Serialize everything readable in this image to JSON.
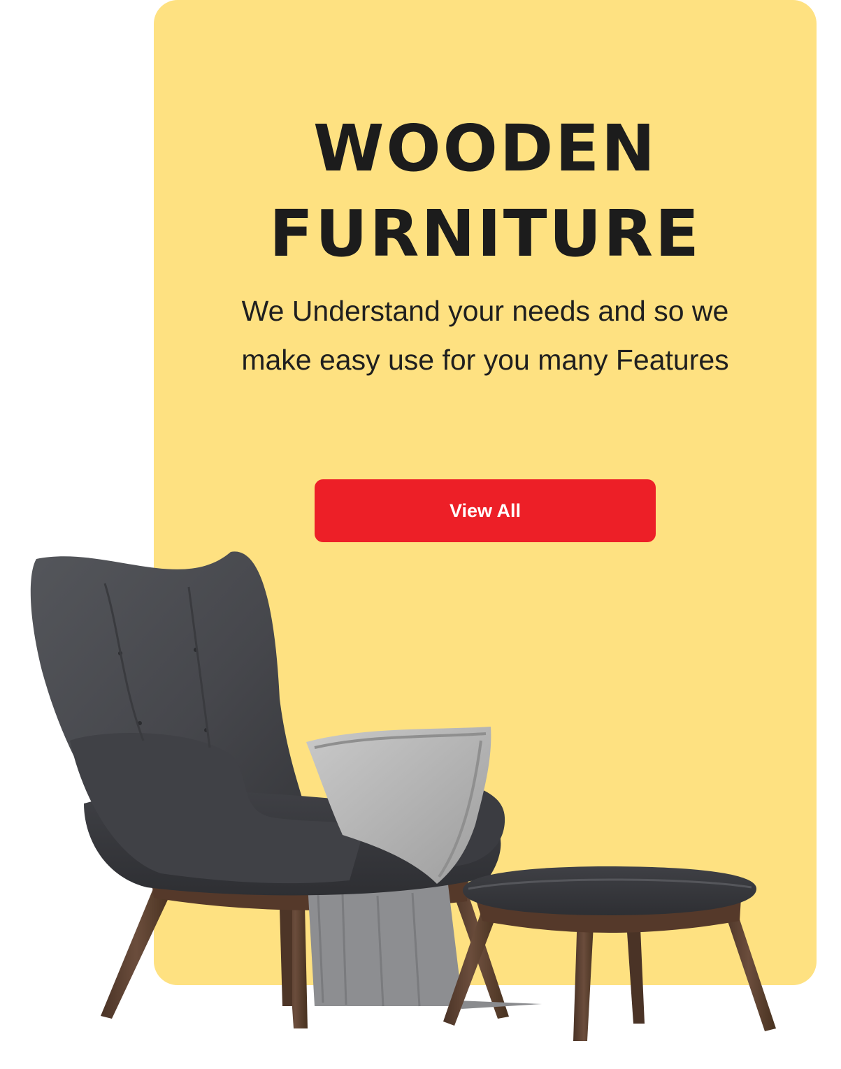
{
  "hero": {
    "title_line1": "WOODEN",
    "title_line2": "FURNITURE",
    "description": "We Understand your needs and so we make easy use for you many Features",
    "button_label": "View All"
  },
  "image": {
    "alt": "Grey upholstered wingback armchair with throw blanket and matching footstool on wooden legs"
  },
  "colors": {
    "banner_bg": "#fee181",
    "button_bg": "#ed1f27",
    "title_text": "#1c1c1c",
    "upholstery": "#4a4b50",
    "wood_legs": "#5a4032",
    "blanket": "#b5b5b5"
  }
}
